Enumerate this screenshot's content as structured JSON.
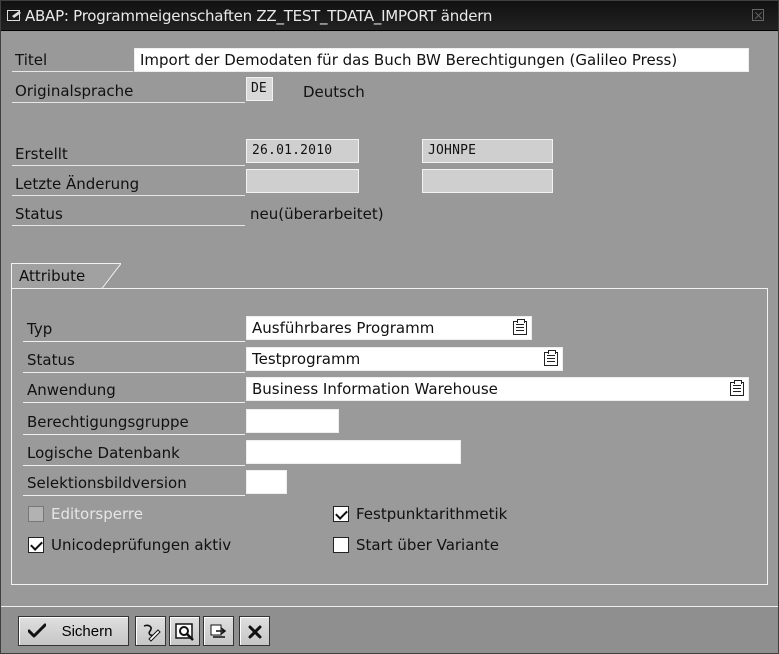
{
  "window": {
    "title": "ABAP: Programmeigenschaften ZZ_TEST_TDATA_IMPORT ändern"
  },
  "program": {
    "title_label": "Titel",
    "title_value": "Import der Demodaten für das Buch BW Berechtigungen (Galileo Press)",
    "language_label": "Originalsprache",
    "language_code": "DE",
    "language_name": "Deutsch",
    "created_label": "Erstellt",
    "created_date": "26.01.2010",
    "created_user": "JOHNPE",
    "last_change_label": "Letzte Änderung",
    "last_change_date": "",
    "last_change_user": "",
    "status_label": "Status",
    "status_value": "neu(überarbeitet)"
  },
  "attributes": {
    "group_label": "Attribute",
    "type_label": "Typ",
    "type_value": "Ausführbares Programm",
    "status_label": "Status",
    "status_value": "Testprogramm",
    "application_label": "Anwendung",
    "application_value": "Business Information Warehouse",
    "authorization_group_label": "Berechtigungsgruppe",
    "authorization_group_value": "",
    "logical_database_label": "Logische Datenbank",
    "logical_database_value": "",
    "selection_screen_version_label": "Selektionsbildversion",
    "selection_screen_version_value": "",
    "editor_lock_label": "Editorsperre",
    "editor_lock_checked": false,
    "fixed_point_arithmetic_label": "Festpunktarithmetik",
    "fixed_point_arithmetic_checked": true,
    "unicode_checks_label": "Unicodeprüfungen aktiv",
    "unicode_checks_checked": true,
    "start_variant_label": "Start über Variante",
    "start_variant_checked": false
  },
  "toolbar": {
    "save_label": "Sichern",
    "icons": [
      "save-check-icon",
      "pencil-edit-icon",
      "magnifier-icon",
      "transport-icon",
      "cancel-icon"
    ]
  },
  "colors": {
    "window_background": "#999999",
    "titlebar": "#111111",
    "field_white": "#ffffff",
    "field_gray": "#d8d8d8"
  }
}
